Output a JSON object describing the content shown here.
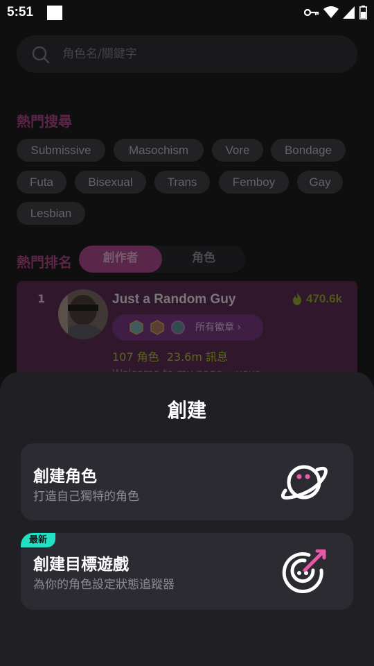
{
  "status_bar": {
    "time": "5:51"
  },
  "search": {
    "placeholder": "角色名/關鍵字"
  },
  "hot_search": {
    "title": "熱門搜尋",
    "tags": [
      "Submissive",
      "Masochism",
      "Vore",
      "Bondage",
      "Futa",
      "Bisexual",
      "Trans",
      "Femboy",
      "Gay",
      "Lesbian"
    ]
  },
  "hot_ranking": {
    "title": "熱門排名",
    "tabs": [
      {
        "label": "創作者",
        "active": true
      },
      {
        "label": "角色",
        "active": false
      }
    ],
    "entries": [
      {
        "rank": "1",
        "name": "Just  a Random Guy",
        "score": "470.6k",
        "badges_label": "所有徽章 ›",
        "characters": "107 角色",
        "messages": "23.6m 訊息",
        "description": "Welcome to my page… your"
      }
    ]
  },
  "create_sheet": {
    "title": "創建",
    "options": [
      {
        "title": "創建角色",
        "subtitle": "打造自己獨特的角色",
        "icon": "planet-icon"
      },
      {
        "badge": "最新",
        "title": "創建目標遊戲",
        "subtitle": "為你的角色設定狀態追蹤器",
        "icon": "target-icon"
      }
    ]
  },
  "colors": {
    "background": "#121212",
    "sheet": "#1f1f24",
    "card": "#2b2b31",
    "accent_pink": "#e55aa6",
    "new_badge": "#21e0c4",
    "score_green": "#8ec31c"
  }
}
